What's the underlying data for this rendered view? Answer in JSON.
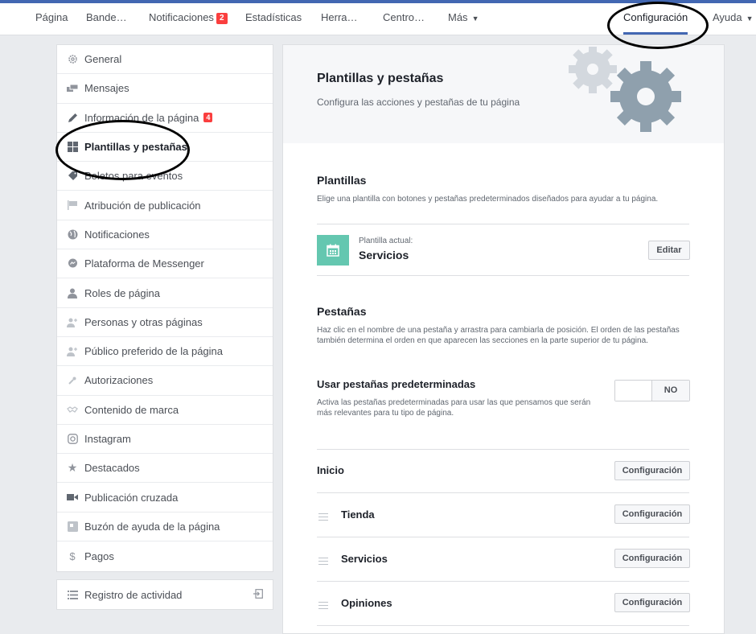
{
  "nav": {
    "items": [
      {
        "label": "Página"
      },
      {
        "label": "Bande…"
      },
      {
        "label": "Notificaciones",
        "badge": "2"
      },
      {
        "label": "Estadísticas"
      },
      {
        "label": "Herra…"
      },
      {
        "label": "Centro…"
      },
      {
        "label": "Más"
      }
    ],
    "settings_label": "Configuración",
    "help_label": "Ayuda"
  },
  "sidebar": {
    "items": [
      {
        "label": "General",
        "icon": "gear-icon"
      },
      {
        "label": "Mensajes",
        "icon": "messages-icon"
      },
      {
        "label": "Información de la página",
        "icon": "pencil-icon",
        "badge": "4"
      },
      {
        "label": "Plantillas y pestañas",
        "icon": "grid-icon",
        "active": true
      },
      {
        "label": "Boletos para eventos",
        "icon": "ticket-icon"
      },
      {
        "label": "Atribución de publicación",
        "icon": "flag-icon"
      },
      {
        "label": "Notificaciones",
        "icon": "globe-icon"
      },
      {
        "label": "Plataforma de Messenger",
        "icon": "messenger-icon"
      },
      {
        "label": "Roles de página",
        "icon": "person-icon"
      },
      {
        "label": "Personas y otras páginas",
        "icon": "person-plus-icon"
      },
      {
        "label": "Público preferido de la página",
        "icon": "person-plus-icon"
      },
      {
        "label": "Autorizaciones",
        "icon": "wrench-icon"
      },
      {
        "label": "Contenido de marca",
        "icon": "handshake-icon"
      },
      {
        "label": "Instagram",
        "icon": "instagram-icon"
      },
      {
        "label": "Destacados",
        "icon": "star-icon"
      },
      {
        "label": "Publicación cruzada",
        "icon": "video-icon"
      },
      {
        "label": "Buzón de ayuda de la página",
        "icon": "inbox-icon"
      },
      {
        "label": "Pagos",
        "icon": "dollar-icon"
      }
    ],
    "activity_label": "Registro de actividad"
  },
  "main": {
    "title": "Plantillas y pestañas",
    "subtitle": "Configura las acciones y pestañas de tu página",
    "templates": {
      "title": "Plantillas",
      "description": "Elige una plantilla con botones y pestañas predeterminados diseñados para ayudar a tu página.",
      "current_label": "Plantilla actual:",
      "current_value": "Servicios",
      "edit_label": "Editar"
    },
    "tabs": {
      "title": "Pestañas",
      "description": "Haz clic en el nombre de una pestaña y arrastra para cambiarla de posición. El orden de las pestañas también determina el orden en que aparecen las secciones en la parte superior de tu página.",
      "default_title": "Usar pestañas predeterminadas",
      "default_desc": "Activa las pestañas predeterminadas para usar las que pensamos que serán más relevantes para tu tipo de página.",
      "toggle_state": "NO",
      "rows": [
        {
          "label": "Inicio",
          "button": "Configuración"
        },
        {
          "label": "Tienda",
          "button": "Configuración"
        },
        {
          "label": "Servicios",
          "button": "Configuración"
        },
        {
          "label": "Opiniones",
          "button": "Configuración"
        }
      ]
    }
  },
  "colors": {
    "accent": "#4267b2",
    "badge": "#fa3e3e",
    "template_icon_bg": "#64c7b0",
    "gear_light": "#d3d8de",
    "gear_dark": "#8fa0ad"
  }
}
